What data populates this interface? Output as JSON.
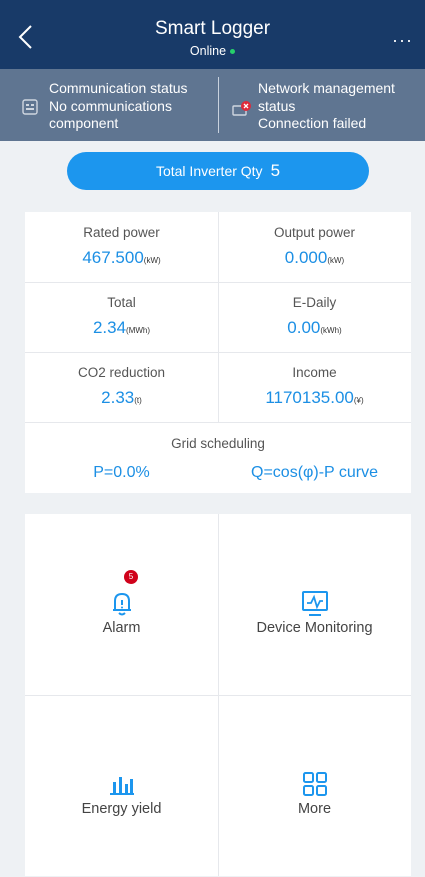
{
  "header": {
    "title": "Smart Logger",
    "status": "Online",
    "colors": {
      "bar": "#183a68",
      "online": "#26d06b"
    }
  },
  "status_bar": {
    "communication": "Communication status\nNo communications component",
    "network": "Network management status\nConnection failed",
    "network_icon_badge": "error"
  },
  "inverters": {
    "label": "Total Inverter Qty",
    "count": "5"
  },
  "metrics": {
    "rated_power": {
      "label": "Rated power",
      "value": "467.500",
      "unit": "(kW)"
    },
    "output_power": {
      "label": "Output power",
      "value": "0.000",
      "unit": "(kW)"
    },
    "total": {
      "label": "Total",
      "value": "2.34",
      "unit": "(MWh)"
    },
    "e_daily": {
      "label": "E-Daily",
      "value": "0.00",
      "unit": "(kWh)"
    },
    "co2": {
      "label": "CO2 reduction",
      "value": "2.33",
      "unit": "(t)"
    },
    "income": {
      "label": "Income",
      "value": "1170135.00",
      "unit": "(¥)"
    },
    "grid": {
      "label": "Grid scheduling",
      "p": "P=0.0%",
      "q": "Q=cos(φ)-P curve"
    }
  },
  "tiles": {
    "alarm": {
      "label": "Alarm",
      "icon": "bell-icon",
      "badge": "5"
    },
    "device_monitoring": {
      "label": "Device Monitoring",
      "icon": "monitor-icon"
    },
    "energy_yield": {
      "label": "Energy yield",
      "icon": "bar-chart-icon"
    },
    "more": {
      "label": "More",
      "icon": "grid-icon"
    }
  },
  "accent_color": "#1c96ee"
}
